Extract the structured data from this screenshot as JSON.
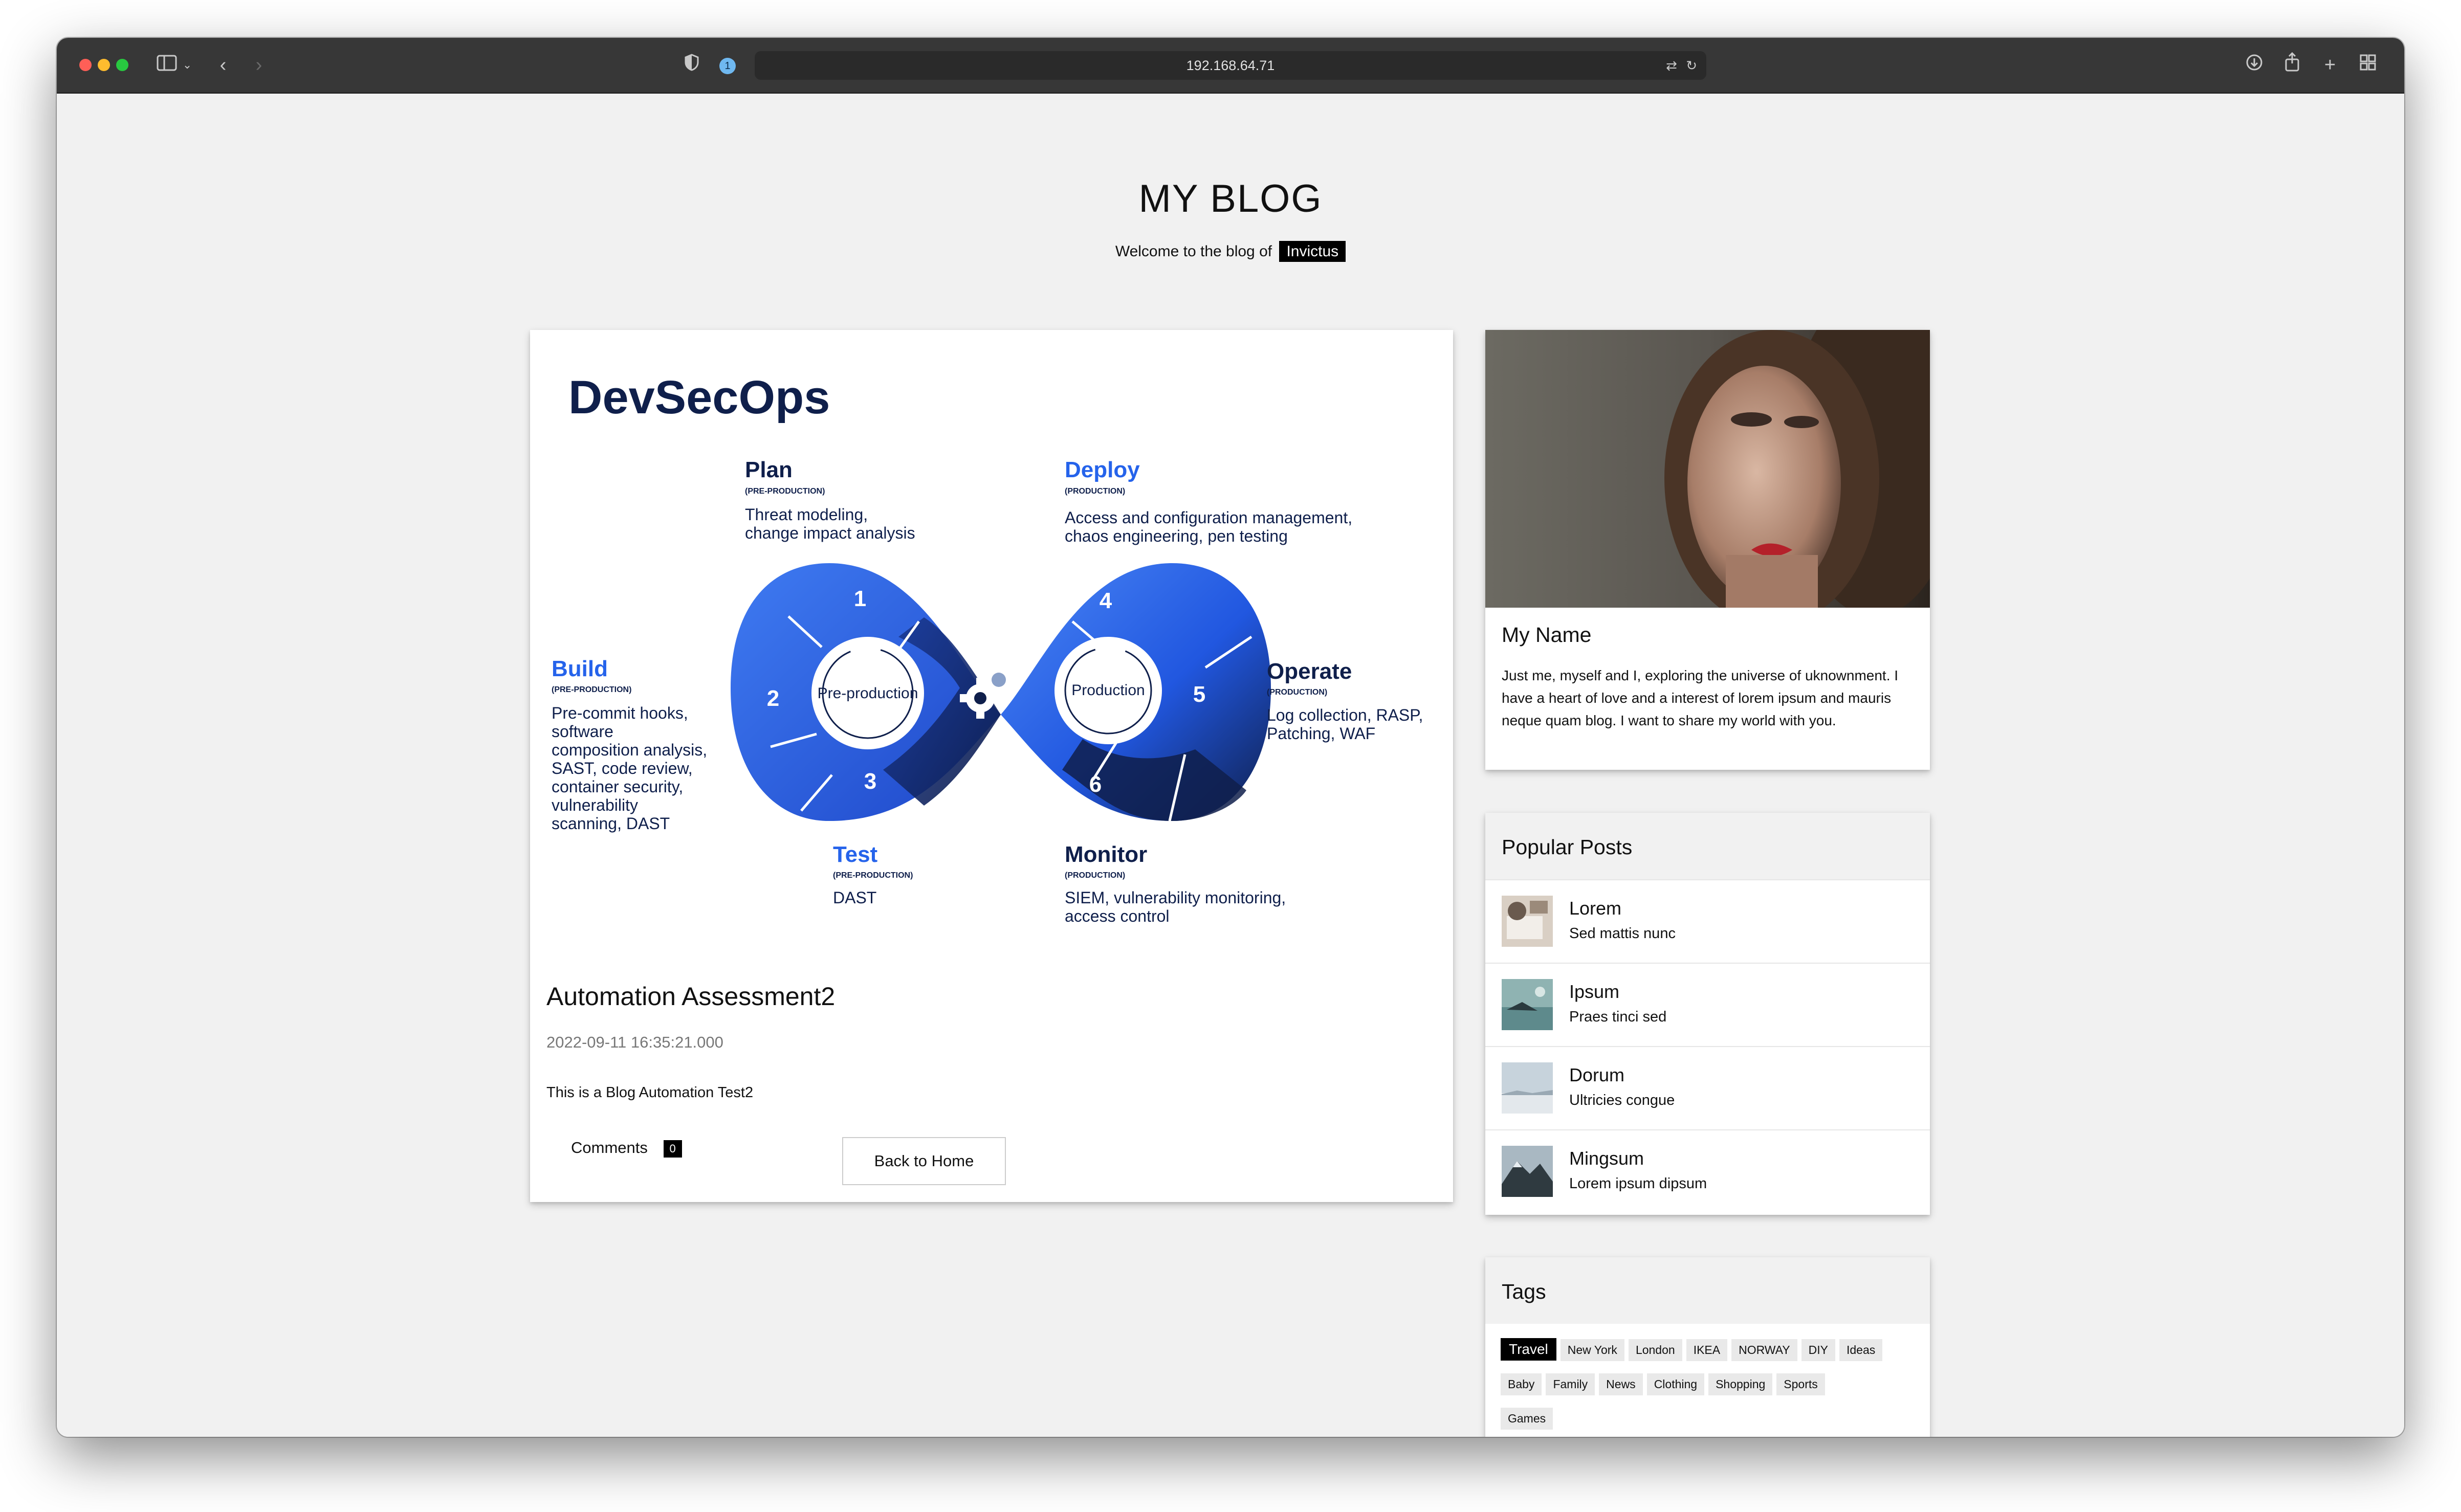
{
  "browser": {
    "url": "192.168.64.71",
    "extension_badge": "1"
  },
  "blog": {
    "title": "MY BLOG",
    "welcome_prefix": "Welcome to the blog of",
    "owner": "Invictus"
  },
  "post": {
    "title": "Automation Assessment2",
    "date": "2022-09-11 16:35:21.000",
    "body": "This is a Blog Automation Test2",
    "comments_label": "Comments",
    "comments_count": "0",
    "back_button": "Back to Home",
    "image": {
      "heading": "DevSecOps",
      "center_left": "Pre-production",
      "center_right": "Production",
      "stages": [
        {
          "num": "1",
          "name": "Plan",
          "phase": "(PRE-PRODUCTION)",
          "desc1": "Threat modeling,",
          "desc2": "change impact analysis"
        },
        {
          "num": "2",
          "name": "Build",
          "phase": "(PRE-PRODUCTION)",
          "desc": [
            "Pre-commit hooks,",
            "software",
            "composition analysis,",
            "SAST, code review,",
            "container security,",
            "vulnerability",
            "scanning, DAST"
          ]
        },
        {
          "num": "3",
          "name": "Test",
          "phase": "(PRE-PRODUCTION)",
          "desc1": "DAST"
        },
        {
          "num": "4",
          "name": "Deploy",
          "phase": "(PRODUCTION)",
          "desc1": "Access and configuration management,",
          "desc2": "chaos engineering, pen testing"
        },
        {
          "num": "5",
          "name": "Operate",
          "phase": "(PRODUCTION)",
          "desc1": "Log collection, RASP,",
          "desc2": "Patching, WAF"
        },
        {
          "num": "6",
          "name": "Monitor",
          "phase": "(PRODUCTION)",
          "desc1": "SIEM, vulnerability monitoring,",
          "desc2": "access control"
        }
      ]
    }
  },
  "profile": {
    "name": "My Name",
    "bio": "Just me, myself and I, exploring the universe of uknownment. I have a heart of love and a interest of lorem ipsum and mauris neque quam blog. I want to share my world with you."
  },
  "popular_posts": {
    "heading": "Popular Posts",
    "items": [
      {
        "title": "Lorem",
        "subtitle": "Sed mattis nunc"
      },
      {
        "title": "Ipsum",
        "subtitle": "Praes tinci sed"
      },
      {
        "title": "Dorum",
        "subtitle": "Ultricies congue"
      },
      {
        "title": "Mingsum",
        "subtitle": "Lorem ipsum dipsum"
      }
    ]
  },
  "tags": {
    "heading": "Tags",
    "items": [
      "Travel",
      "New York",
      "London",
      "IKEA",
      "NORWAY",
      "DIY",
      "Ideas",
      "Baby",
      "Family",
      "News",
      "Clothing",
      "Shopping",
      "Sports",
      "Games"
    ],
    "active": "Travel"
  },
  "icons": {
    "sidebar": "sidebar-icon",
    "back": "chevron-left-icon",
    "forward": "chevron-right-icon",
    "shield": "shield-icon",
    "translate": "translate-icon",
    "reload": "reload-icon",
    "download": "download-icon",
    "share": "share-icon",
    "new_tab": "plus-icon",
    "tabs": "tab-overview-icon"
  },
  "colors": {
    "accent_blue": "#2563eb",
    "navy": "#0f1f4b",
    "page_bg": "#f1f1f1",
    "toolbar_bg": "#373737"
  }
}
